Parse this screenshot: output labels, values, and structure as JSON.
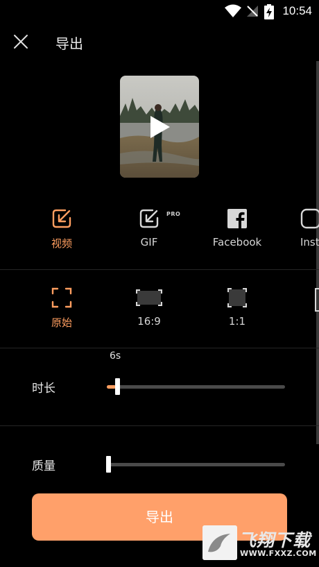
{
  "status_bar": {
    "time": "10:54"
  },
  "header": {
    "title": "导出"
  },
  "formats": [
    {
      "label": "视频",
      "active": true
    },
    {
      "label": "GIF",
      "badge": "PRO",
      "active": false
    },
    {
      "label": "Facebook",
      "active": false
    },
    {
      "label": "Inst",
      "active": false
    }
  ],
  "ratios": [
    {
      "label": "原始",
      "active": true
    },
    {
      "label": "16:9",
      "active": false
    },
    {
      "label": "1:1",
      "active": false
    }
  ],
  "duration": {
    "label": "时长",
    "value": "6s",
    "level": 0.05
  },
  "quality": {
    "label": "质量",
    "level": 0.0
  },
  "export_button": {
    "label": "导出"
  },
  "watermark": {
    "title": "飞翔下载",
    "url": "WWW.FXXZ.COM"
  },
  "colors": {
    "accent": "#ff9e60",
    "button": "#ffa06a",
    "background": "#000000"
  }
}
